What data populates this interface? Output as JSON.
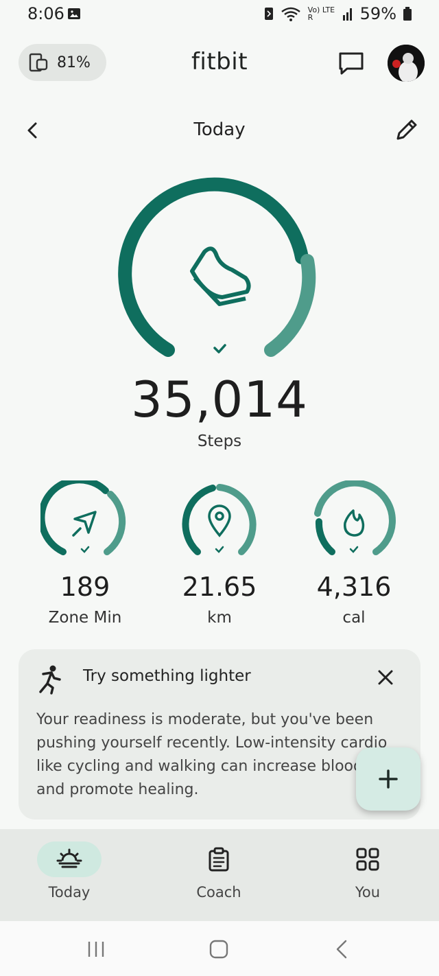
{
  "status_bar": {
    "time": "8:06",
    "network": "Vo) LTE R",
    "battery": "59%"
  },
  "header": {
    "device_battery": "81%",
    "app_title": "fitbit"
  },
  "nav": {
    "title": "Today"
  },
  "steps": {
    "value": "35,014",
    "label": "Steps",
    "goal_met": true
  },
  "stats": [
    {
      "value": "189",
      "label": "Zone Min",
      "icon": "zone-minutes-icon"
    },
    {
      "value": "21.65",
      "label": "km",
      "icon": "location-pin-icon"
    },
    {
      "value": "4,316",
      "label": "cal",
      "icon": "flame-icon"
    }
  ],
  "tip": {
    "title": "Try something lighter",
    "body": "Your readiness is moderate, but you've been pushing yourself recently. Low-intensity cardio like cycling and walking can increase blood and promote healing."
  },
  "bottom_nav": [
    {
      "label": "Today",
      "active": true
    },
    {
      "label": "Coach",
      "active": false
    },
    {
      "label": "You",
      "active": false
    }
  ],
  "colors": {
    "accent": "#0f6e5e",
    "accent_light": "#4f9c8b",
    "background": "#f6f8f6"
  }
}
